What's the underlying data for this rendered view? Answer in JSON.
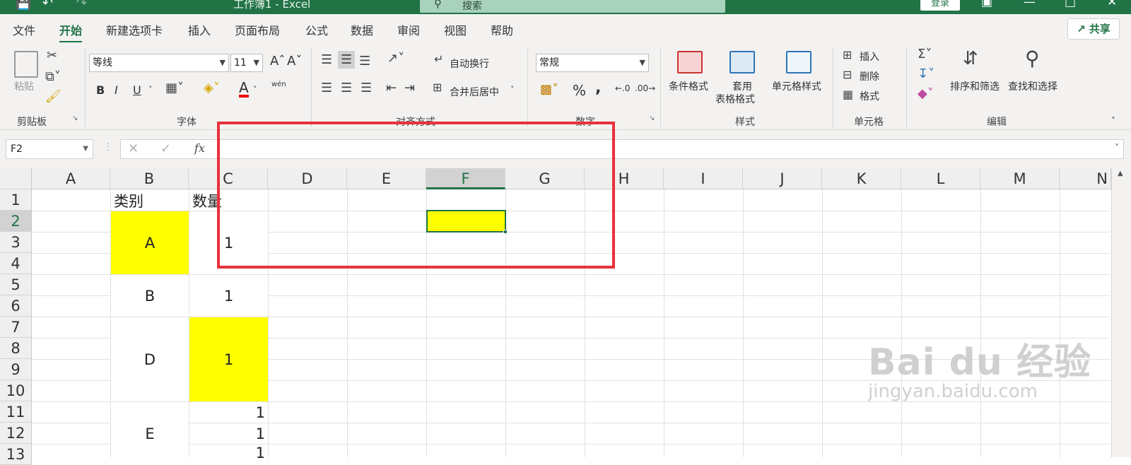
{
  "titlebar": {
    "doc_title": "工作簿1 - Excel",
    "search_placeholder": "搜索",
    "login_label": "登录"
  },
  "menu": {
    "tabs": [
      "文件",
      "开始",
      "新建选项卡",
      "插入",
      "页面布局",
      "公式",
      "数据",
      "审阅",
      "视图",
      "帮助"
    ],
    "active_tab": "开始",
    "share_label": "共享"
  },
  "ribbon": {
    "clipboard": {
      "paste_label": "粘贴",
      "group_label": "剪贴板"
    },
    "font": {
      "font_name": "等线",
      "font_size": "11",
      "group_label": "字体",
      "bold": "B",
      "italic": "I",
      "underline": "U",
      "phonetic": "wén"
    },
    "alignment": {
      "wrap_label": "自动换行",
      "merge_label": "合并后居中",
      "group_label": "对齐方式"
    },
    "number": {
      "format": "常规",
      "percent": "%",
      "comma": ",",
      "group_label": "数字"
    },
    "styles": {
      "conditional_label": "条件格式",
      "table_label_1": "套用",
      "table_label_2": "表格格式",
      "cell_style_label": "单元格样式",
      "group_label": "样式"
    },
    "cells": {
      "insert_label": "插入",
      "delete_label": "删除",
      "format_label": "格式",
      "group_label": "单元格"
    },
    "editing": {
      "sort_label": "排序和筛选",
      "find_label": "查找和选择",
      "group_label": "编辑"
    }
  },
  "formula_bar": {
    "name_box": "F2",
    "fx": "fx",
    "formula": ""
  },
  "sheet": {
    "columns": [
      "A",
      "B",
      "C",
      "D",
      "E",
      "F",
      "G",
      "H",
      "I",
      "J",
      "K",
      "L",
      "M",
      "N"
    ],
    "rows": [
      "1",
      "2",
      "3",
      "4",
      "5",
      "6",
      "7",
      "8",
      "9",
      "10",
      "11",
      "12",
      "13"
    ],
    "selected_column": "F",
    "selected_row": "2",
    "cells": {
      "B1": "类别",
      "C1": "数量",
      "B2": "A",
      "C2": "1",
      "B5": "B",
      "C5": "1",
      "B7": "D",
      "C7": "1",
      "B11": "E",
      "C11": "1",
      "C12": "1",
      "C13": "1"
    },
    "fill_color": "#ffff00",
    "accent_color": "#217346"
  },
  "watermark": {
    "line1": "Bai du 经验",
    "line2": "jingyan.baidu.com"
  }
}
